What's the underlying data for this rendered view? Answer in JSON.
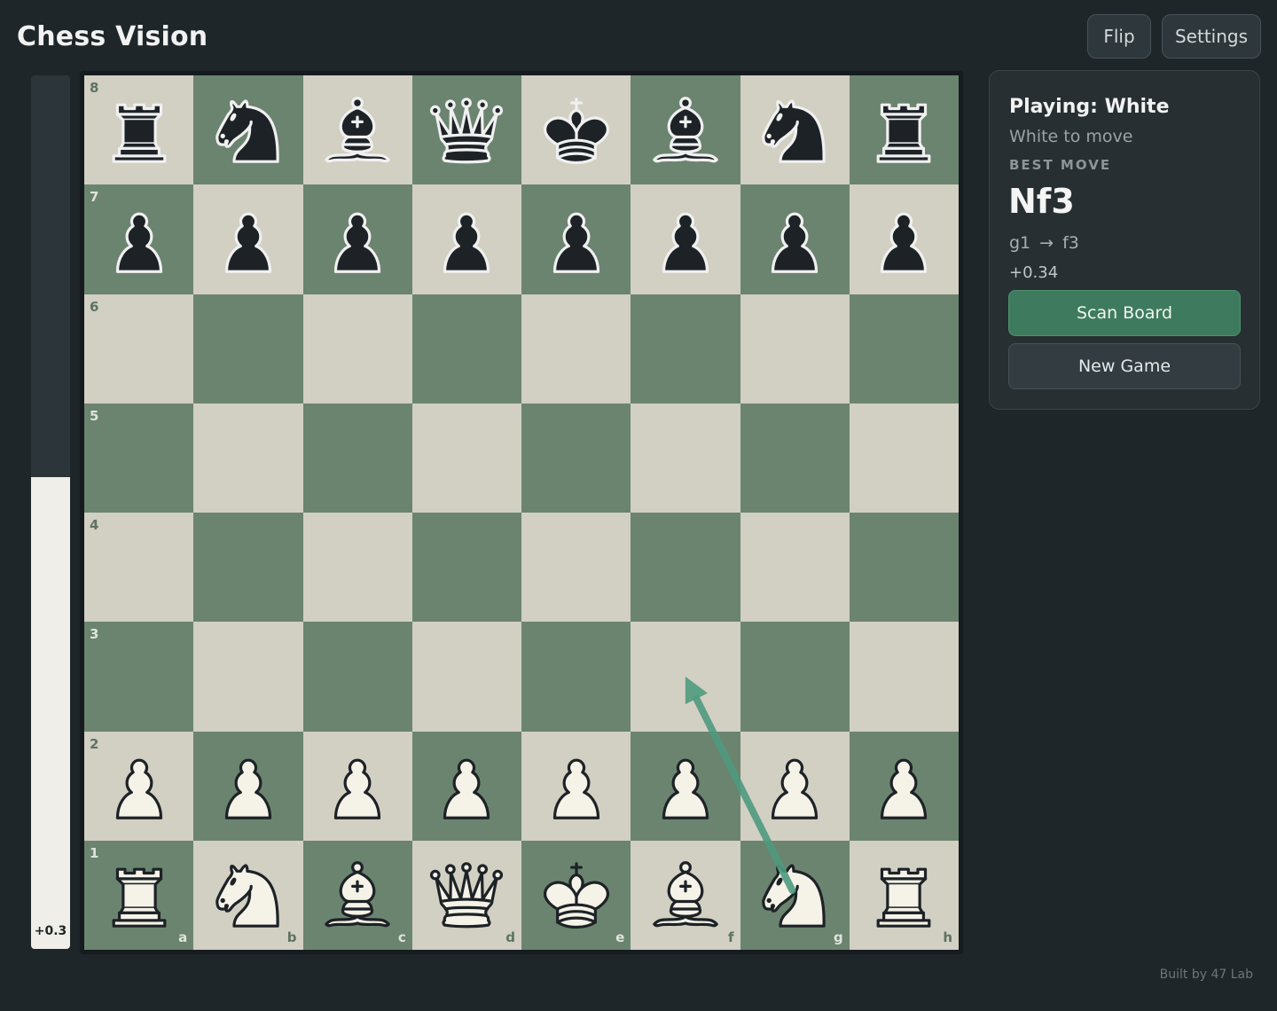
{
  "app": {
    "title": "Chess Vision"
  },
  "toolbar": {
    "flip_label": "Flip",
    "settings_label": "Settings"
  },
  "eval": {
    "label": "+0.3",
    "white_share": 0.54
  },
  "board": {
    "ranks": [
      "8",
      "7",
      "6",
      "5",
      "4",
      "3",
      "2",
      "1"
    ],
    "files": [
      "a",
      "b",
      "c",
      "d",
      "e",
      "f",
      "g",
      "h"
    ],
    "squares": [
      [
        "bR",
        "bN",
        "bB",
        "bQ",
        "bK",
        "bB",
        "bN",
        "bR"
      ],
      [
        "bP",
        "bP",
        "bP",
        "bP",
        "bP",
        "bP",
        "bP",
        "bP"
      ],
      [
        "",
        "",
        "",
        "",
        "",
        "",
        "",
        ""
      ],
      [
        "",
        "",
        "",
        "",
        "",
        "",
        "",
        ""
      ],
      [
        "",
        "",
        "",
        "",
        "",
        "",
        "",
        ""
      ],
      [
        "",
        "",
        "",
        "",
        "",
        "",
        "",
        ""
      ],
      [
        "wP",
        "wP",
        "wP",
        "wP",
        "wP",
        "wP",
        "wP",
        "wP"
      ],
      [
        "wR",
        "wN",
        "wB",
        "wQ",
        "wK",
        "wB",
        "wN",
        "wR"
      ]
    ],
    "arrow": {
      "from": "g1",
      "to": "f3",
      "color": "#4f9a80"
    },
    "colors": {
      "light": "#d2cfc3",
      "dark": "#6b8470"
    }
  },
  "panel": {
    "playing": "Playing: White",
    "to_move": "White to move",
    "best_move_label": "BEST MOVE",
    "best_move": "Nf3",
    "from_sq": "g1",
    "arrow_glyph": "→",
    "to_sq": "f3",
    "score": "+0.34",
    "scan_label": "Scan Board",
    "new_game_label": "New Game"
  },
  "footer": {
    "credit": "Built by 47 Lab"
  },
  "colors": {
    "accent": "#3e7b5e",
    "background": "#1f2629"
  }
}
